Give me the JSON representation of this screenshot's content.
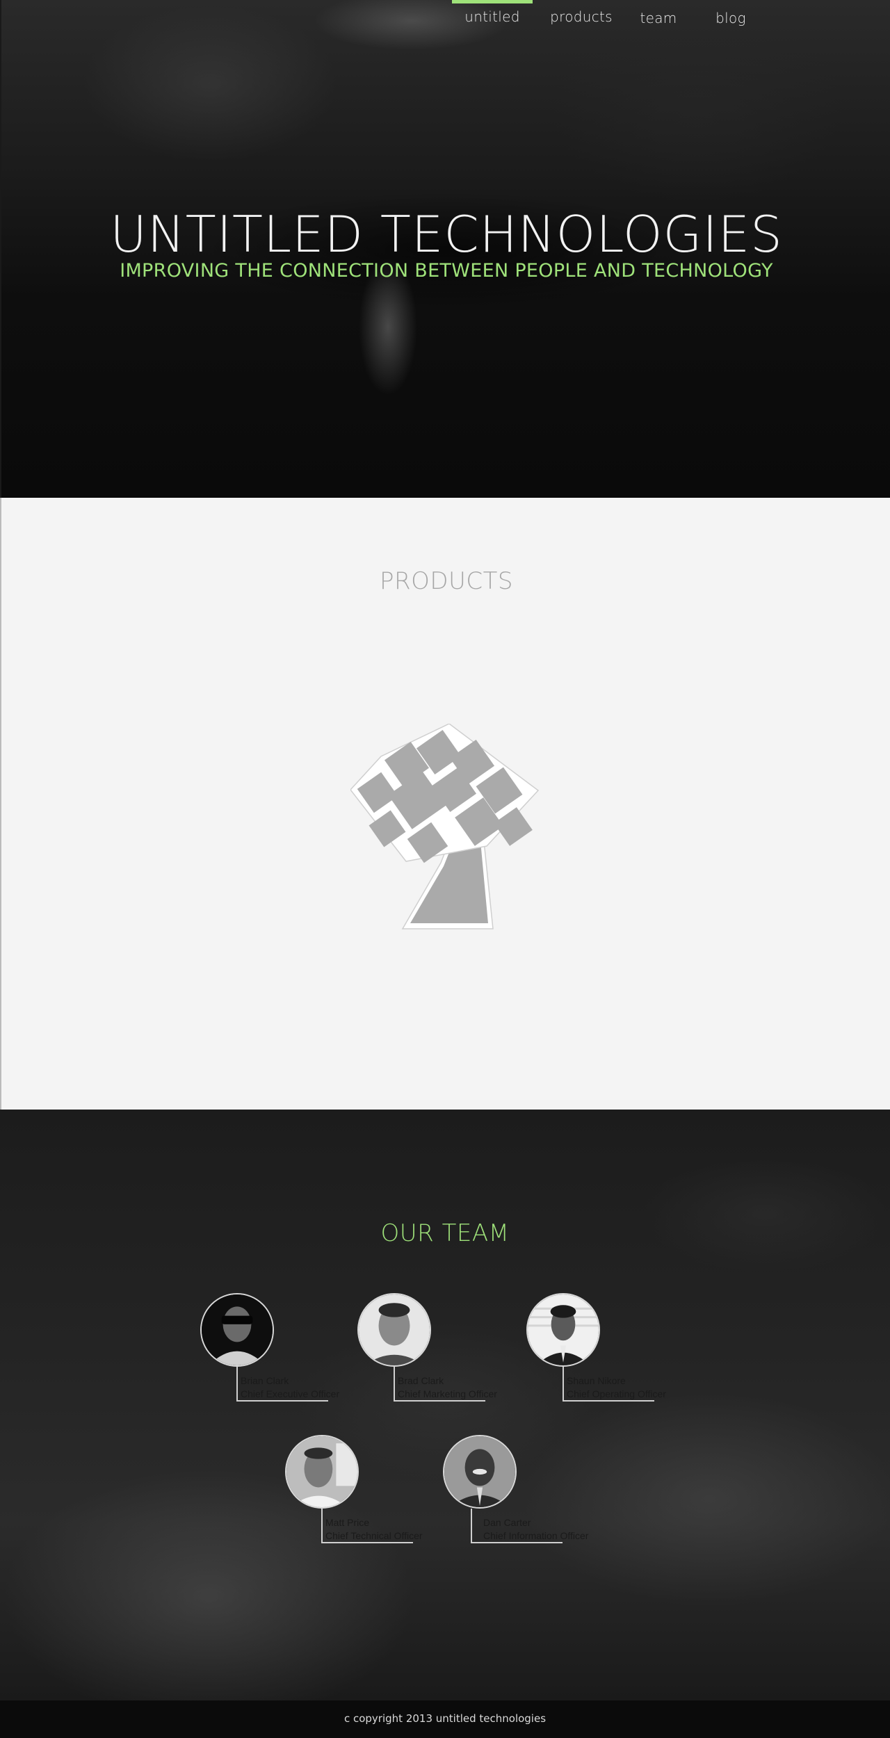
{
  "nav": {
    "items": [
      {
        "label": "untitled",
        "active": true
      },
      {
        "label": "products",
        "active": false
      },
      {
        "label": "team",
        "active": false
      },
      {
        "label": "blog",
        "active": false
      }
    ]
  },
  "hero": {
    "title": "UNTITLED TECHNOLOGIES",
    "tagline": "IMPROVING THE CONNECTION BETWEEN PEOPLE AND TECHNOLOGY"
  },
  "products": {
    "heading": "PRODUCTS",
    "logo_icon": "tree-logo-icon"
  },
  "team": {
    "heading": "OUR TEAM",
    "members": [
      {
        "name": "Brian Clark",
        "role": "Chief Executive Officer"
      },
      {
        "name": "Brad Clark",
        "role": "Chief Marketing Officer"
      },
      {
        "name": "Shaun Nikore",
        "role": "Chief Operating Officer"
      },
      {
        "name": "Matt Price",
        "role": "Chief Technical Officer"
      },
      {
        "name": "Dan Carter",
        "role": "Chief Information Officer"
      }
    ]
  },
  "footer": {
    "copyright": "c copyright 2013 untitled technologies"
  },
  "colors": {
    "accent": "#9fe27a",
    "hero_bg": "#0d0d0d",
    "products_bg": "#f4f4f4",
    "team_bg": "#242424",
    "footer_bg": "#0b0b0b"
  }
}
